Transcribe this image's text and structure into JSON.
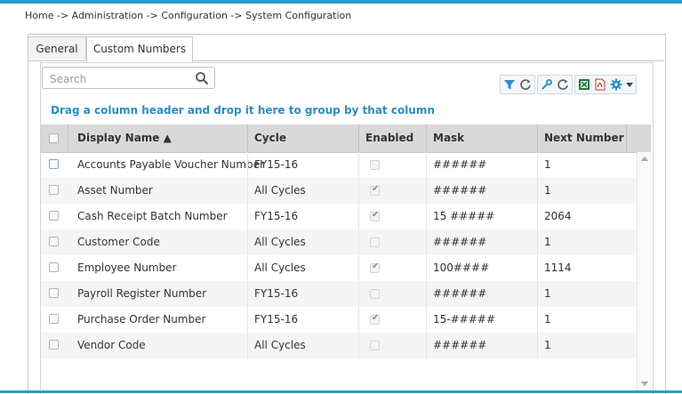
{
  "breadcrumb": "Home -> Administration -> Configuration -> System Configuration",
  "tabs": [
    {
      "label": "General",
      "active": false
    },
    {
      "label": "Custom Numbers",
      "active": true
    }
  ],
  "search": {
    "placeholder": "Search",
    "value": ""
  },
  "toolbar": {
    "icons": [
      "filter-icon",
      "refresh-icon",
      "wrench-icon",
      "refresh-icon",
      "excel-icon",
      "pdf-icon",
      "gear-icon",
      "chevron-down-icon"
    ]
  },
  "group_hint": "Drag a column header and drop it here to group by that column",
  "columns": {
    "display_name": "Display Name ▲",
    "cycle": "Cycle",
    "enabled": "Enabled",
    "mask": "Mask",
    "next_number": "Next Number"
  },
  "rows": [
    {
      "name": "Accounts Payable Voucher Number",
      "cycle": "FY15-16",
      "enabled": false,
      "mask": "######",
      "next": "1"
    },
    {
      "name": "Asset Number",
      "cycle": "All Cycles",
      "enabled": true,
      "mask": "######",
      "next": "1"
    },
    {
      "name": "Cash Receipt Batch Number",
      "cycle": "FY15-16",
      "enabled": true,
      "mask": "15 #####",
      "next": "2064"
    },
    {
      "name": "Customer Code",
      "cycle": "All Cycles",
      "enabled": false,
      "mask": "######",
      "next": "1"
    },
    {
      "name": "Employee Number",
      "cycle": "All Cycles",
      "enabled": true,
      "mask": "100####",
      "next": "1114"
    },
    {
      "name": "Payroll Register Number",
      "cycle": "FY15-16",
      "enabled": false,
      "mask": "######",
      "next": "1"
    },
    {
      "name": "Purchase Order Number",
      "cycle": "FY15-16",
      "enabled": true,
      "mask": "15-#####",
      "next": "1"
    },
    {
      "name": "Vendor Code",
      "cycle": "All Cycles",
      "enabled": false,
      "mask": "######",
      "next": "1"
    }
  ],
  "colors": {
    "accent": "#2d9ccc",
    "link": "#2d8cbf",
    "header_bg": "#d9d9d9"
  }
}
